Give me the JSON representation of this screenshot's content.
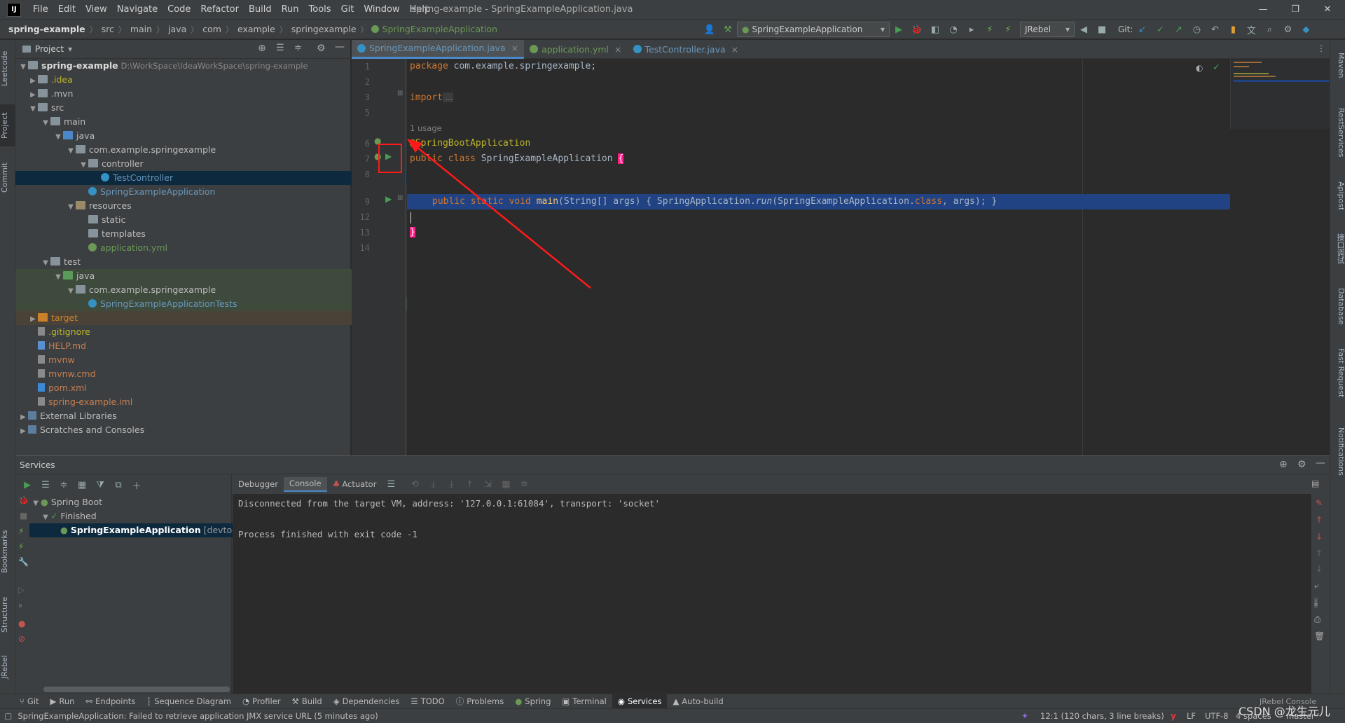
{
  "menu": {
    "items": [
      "File",
      "Edit",
      "View",
      "Navigate",
      "Code",
      "Refactor",
      "Build",
      "Run",
      "Tools",
      "Git",
      "Window",
      "Help"
    ],
    "window_title": "spring-example - SpringExampleApplication.java"
  },
  "breadcrumb": [
    "spring-example",
    "src",
    "main",
    "java",
    "com",
    "example",
    "springexample",
    "SpringExampleApplication"
  ],
  "toolbar": {
    "run_config": "SpringExampleApplication",
    "jrebel": "JRebel",
    "git_label": "Git:"
  },
  "left_stripe": [
    "Leetcode",
    "Project",
    "Commit",
    "Bookmarks",
    "Structure",
    "JRebel"
  ],
  "right_stripe": [
    "Maven",
    "RestServices",
    "Apipost",
    "接口调试",
    "Database",
    "Fast Request",
    "Notifications"
  ],
  "project": {
    "title": "Project",
    "root_name": "spring-example",
    "root_path": "D:\\WorkSpace\\IdeaWorkSpace\\spring-example",
    "items": [
      {
        "label": ".idea"
      },
      {
        "label": ".mvn"
      },
      {
        "label": "src"
      },
      {
        "label": "main"
      },
      {
        "label": "java"
      },
      {
        "label": "com.example.springexample"
      },
      {
        "label": "controller"
      },
      {
        "label": "TestController"
      },
      {
        "label": "SpringExampleApplication"
      },
      {
        "label": "resources"
      },
      {
        "label": "static"
      },
      {
        "label": "templates"
      },
      {
        "label": "application.yml"
      },
      {
        "label": "test"
      },
      {
        "label": "java"
      },
      {
        "label": "com.example.springexample"
      },
      {
        "label": "SpringExampleApplicationTests"
      },
      {
        "label": "target"
      },
      {
        "label": ".gitignore"
      },
      {
        "label": "HELP.md"
      },
      {
        "label": "mvnw"
      },
      {
        "label": "mvnw.cmd"
      },
      {
        "label": "pom.xml"
      },
      {
        "label": "spring-example.iml"
      },
      {
        "label": "External Libraries"
      },
      {
        "label": "Scratches and Consoles"
      }
    ]
  },
  "editor": {
    "tabs": [
      "SpringExampleApplication.java",
      "application.yml",
      "TestController.java"
    ],
    "line_numbers": [
      "1",
      "2",
      "3",
      "5",
      "",
      "6",
      "7",
      "8",
      "",
      "9",
      "12",
      "13",
      "14"
    ],
    "code": {
      "l1_kw": "package",
      "l1_rest": " com.example.springexample;",
      "l3_kw": "import",
      "l3_rest": " ...",
      "usage": "1 usage",
      "l6": "@SpringBootApplication",
      "l7_kw": "public class",
      "l7_name": " SpringExampleApplication ",
      "l7_brace": "{",
      "l9_kw": "public static void",
      "l9_fn": " main",
      "l9_args": "(String[] args) { SpringApplication.",
      "l9_run": "run",
      "l9_rest1": "(SpringExampleApplication.",
      "l9_cls": "class",
      "l9_rest2": ", args); }",
      "l13_brace": "}"
    }
  },
  "services": {
    "title": "Services",
    "tree": [
      "Spring Boot",
      "Finished",
      "SpringExampleApplication"
    ],
    "tree_tag": "[devtools]",
    "console_tabs": [
      "Debugger",
      "Console",
      "Actuator"
    ],
    "console_lines": [
      "Disconnected from the target VM, address: '127.0.0.1:61084', transport: 'socket'",
      "",
      "Process finished with exit code -1"
    ]
  },
  "bottom_tools": [
    "Git",
    "Run",
    "Endpoints",
    "Sequence Diagram",
    "Profiler",
    "Build",
    "Dependencies",
    "TODO",
    "Problems",
    "Spring",
    "Terminal",
    "Services",
    "Auto-build",
    "JRebel Console"
  ],
  "status": {
    "message": "SpringExampleApplication: Failed to retrieve application JMX service URL (5 minutes ago)",
    "position": "12:1 (120 chars, 3 line breaks)",
    "line_sep": "LF",
    "encoding": "UTF-8",
    "indent": "4 spaces",
    "branch": "master",
    "watermark": "CSDN @龙生元儿"
  },
  "colors": {
    "accent": "#4a88c7",
    "highlight_box": "#ff1a1a",
    "selection": "#214283"
  }
}
